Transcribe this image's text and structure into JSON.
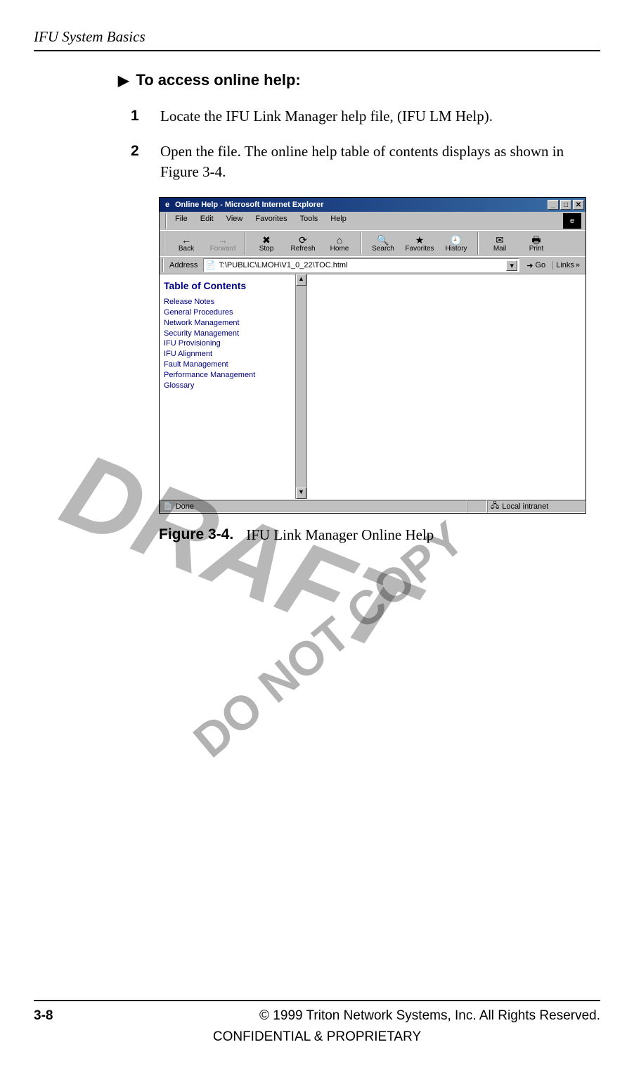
{
  "header": {
    "running_head": "IFU System Basics"
  },
  "procedure": {
    "title": "To access online help:",
    "steps": [
      {
        "num": "1",
        "text": "Locate the IFU Link Manager help file, (IFU LM Help)."
      },
      {
        "num": "2",
        "text": "Open the file. The online help table of contents displays as shown in Figure 3-4."
      }
    ]
  },
  "ie_window": {
    "title": "Online Help - Microsoft Internet Explorer",
    "menus": [
      "File",
      "Edit",
      "View",
      "Favorites",
      "Tools",
      "Help"
    ],
    "toolbar": [
      {
        "icon": "←",
        "label": "Back",
        "state": "enabled"
      },
      {
        "icon": "→",
        "label": "Forward",
        "state": "disabled"
      },
      {
        "icon": "✖",
        "label": "Stop",
        "state": "enabled"
      },
      {
        "icon": "⟳",
        "label": "Refresh",
        "state": "enabled"
      },
      {
        "icon": "⌂",
        "label": "Home",
        "state": "enabled"
      },
      {
        "icon": "🔍",
        "label": "Search",
        "state": "enabled"
      },
      {
        "icon": "★",
        "label": "Favorites",
        "state": "enabled"
      },
      {
        "icon": "🕘",
        "label": "History",
        "state": "enabled"
      },
      {
        "icon": "✉",
        "label": "Mail",
        "state": "enabled"
      },
      {
        "icon": "🖶",
        "label": "Print",
        "state": "enabled"
      }
    ],
    "address_label": "Address",
    "address_value": "T:\\PUBLIC\\LMOH\\V1_0_22\\TOC.html",
    "go_label": "Go",
    "links_label": "Links",
    "toc_heading": "Table of Contents",
    "toc_items": [
      "Release Notes",
      "General Procedures",
      "Network Management",
      "Security Management",
      "IFU Provisioning",
      "IFU Alignment",
      "Fault Management",
      "Performance Management",
      "Glossary"
    ],
    "status_left": "Done",
    "status_right": "Local intranet"
  },
  "figure": {
    "number": "Figure 3-4.",
    "caption": "IFU Link Manager Online Help"
  },
  "watermarks": {
    "draft": "DRAFT",
    "do_not_copy": "DO NOT COPY"
  },
  "footer": {
    "page_number": "3-8",
    "copyright": "© 1999 Triton Network Systems, Inc. All Rights Reserved.",
    "confidential": "CONFIDENTIAL & PROPRIETARY"
  }
}
